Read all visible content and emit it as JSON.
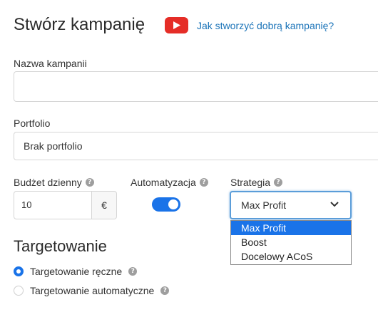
{
  "header": {
    "title": "Stwórz kampanię",
    "video_icon": "youtube-play-icon",
    "help_link": "Jak stworzyć dobrą kampanię?"
  },
  "campaign_name": {
    "label": "Nazwa kampanii",
    "value": ""
  },
  "portfolio": {
    "label": "Portfolio",
    "value": "Brak portfolio"
  },
  "budget": {
    "label": "Budżet dzienny",
    "value": "10",
    "currency": "€"
  },
  "automation": {
    "label": "Automatyzacja",
    "enabled": true
  },
  "strategy": {
    "label": "Strategia",
    "selected": "Max Profit",
    "options": [
      "Max Profit",
      "Boost",
      "Docelowy ACoS"
    ]
  },
  "targeting": {
    "title": "Targetowanie",
    "options": [
      {
        "label": "Targetowanie ręczne",
        "selected": true
      },
      {
        "label": "Targetowanie automatyczne",
        "selected": false
      }
    ]
  },
  "colors": {
    "accent": "#1a73e8",
    "link": "#1a73b8",
    "youtube": "#e52d27"
  }
}
